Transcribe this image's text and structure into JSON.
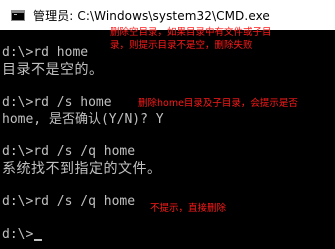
{
  "window": {
    "title": "管理员: C:\\Windows\\system32\\CMD.exe"
  },
  "console": {
    "lines": [
      "d:\\>rd home",
      "目录不是空的。",
      "d:\\>rd /s home",
      "home, 是否确认(Y/N)? Y",
      "d:\\>rd /s /q home",
      "系统找不到指定的文件。",
      "d:\\>rd /s /q home",
      "d:\\>"
    ]
  },
  "annotations": {
    "note1_line1": "删除空目录，如果目录中有文件或子目",
    "note1_line2": "录，则提示目录不是空，删除失败",
    "note2": "删除home目录及子目录，会提示是否",
    "note3": "不提示，直接删除"
  },
  "colors": {
    "console_bg": "#000000",
    "console_text": "#c0c0c0",
    "annotation": "#ff1a1a",
    "titlebar_bg": "#ffffff"
  },
  "icons": {
    "app": "cmd-console-icon"
  }
}
